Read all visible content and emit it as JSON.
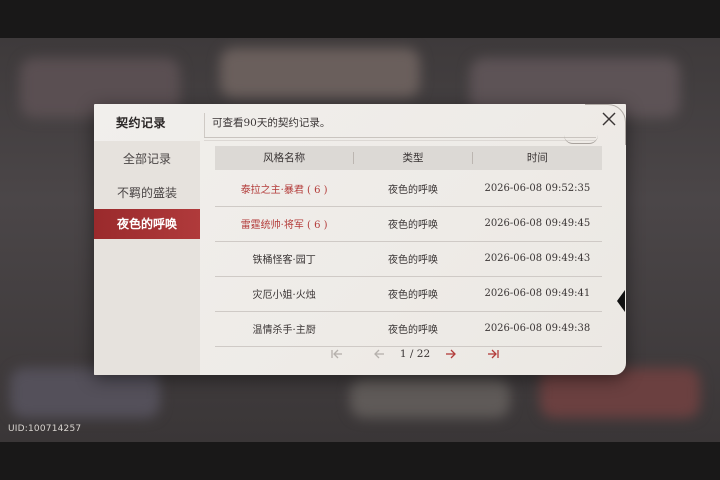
{
  "uid": "UID:100714257",
  "dialog": {
    "title": "契约记录",
    "subtitle": "可查看90天的契约记录。"
  },
  "nav": {
    "items": [
      {
        "label": "全部记录",
        "active": false
      },
      {
        "label": "不羁的盛装",
        "active": false
      },
      {
        "label": "夜色的呼唤",
        "active": true
      }
    ]
  },
  "table": {
    "headers": [
      "风格名称",
      "类型",
      "时间"
    ],
    "rows": [
      {
        "name": "泰拉之主·暴君 ( 6 )",
        "type": "夜色的呼唤",
        "time": "2026-06-08 09:52:35",
        "highlight": true
      },
      {
        "name": "雷霆统帅·将军 ( 6 )",
        "type": "夜色的呼唤",
        "time": "2026-06-08 09:49:45",
        "highlight": true
      },
      {
        "name": "铁桶怪客·园丁",
        "type": "夜色的呼唤",
        "time": "2026-06-08 09:49:43",
        "highlight": false
      },
      {
        "name": "灾厄小姐·火烛",
        "type": "夜色的呼唤",
        "time": "2026-06-08 09:49:41",
        "highlight": false
      },
      {
        "name": "温情杀手·主厨",
        "type": "夜色的呼唤",
        "time": "2026-06-08 09:49:38",
        "highlight": false
      }
    ]
  },
  "pagination": {
    "current": "1",
    "separator": "/",
    "total": "22"
  },
  "colors": {
    "accent": "#b33c3a",
    "active_tab": "#9a2a2c",
    "panel": "#efece8"
  }
}
